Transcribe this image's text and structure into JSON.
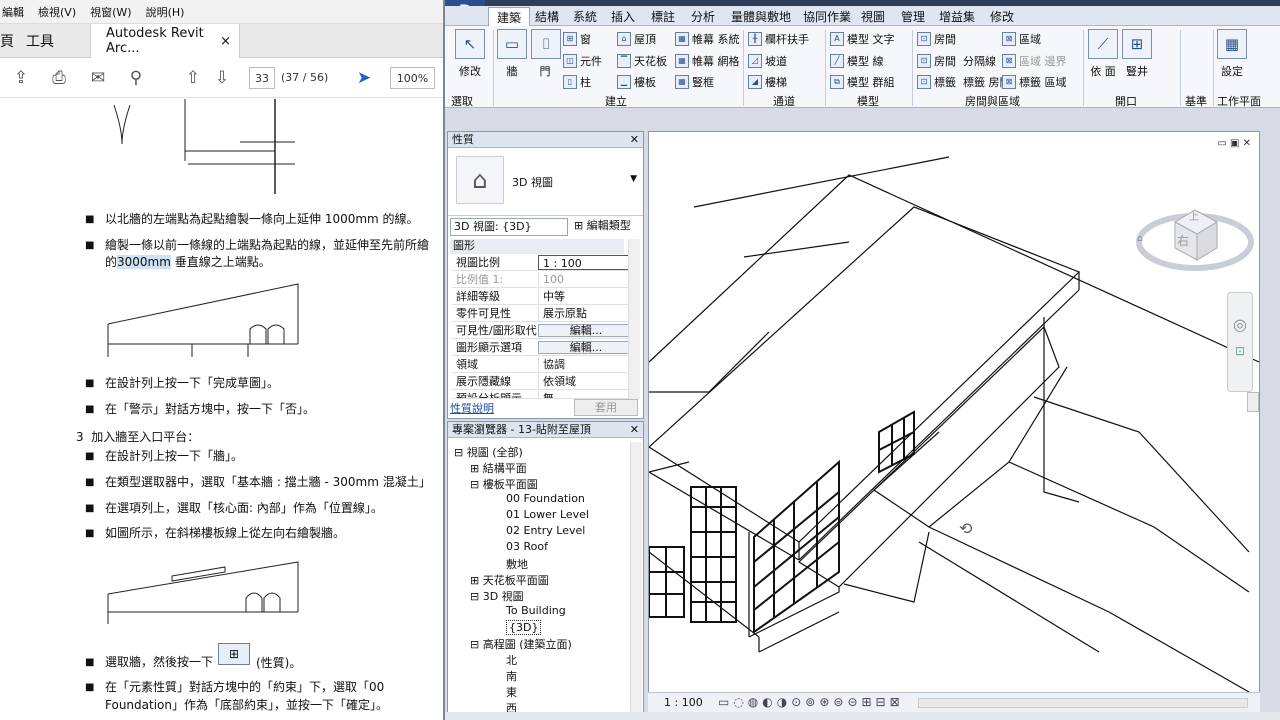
{
  "pdf": {
    "menu": [
      "編輯",
      "檢視(V)",
      "視窗(W)",
      "說明(H)"
    ],
    "tabs": {
      "left": "頁",
      "tools": "工具",
      "doc": "Autodesk Revit Arc...",
      "close": "×"
    },
    "page_num": "33",
    "page_of": "(37 / 56)",
    "zoom": "100%",
    "bullets": [
      "以北牆的左端點為起點繪製一條向上延伸 1000mm 的線。",
      "繪製一條以前一條線的上端點為起點的線，並延伸至先前所繪",
      "在設計列上按一下「完成草圖」。",
      "在「警示」對話方塊中，按一下「否」。",
      "在設計列上按一下「牆」。",
      "在類型選取器中，選取「基本牆 : 擋土牆 - 300mm 混凝土」",
      "在選項列上，選取「核心面: 內部」作為「位置線」。",
      "如圖所示，在斜梯樓板線上從左向右繪製牆。",
      "選取牆，然後按一下",
      "在「元素性質」對話方塊中的「約束」下，選取「00"
    ],
    "b2_cont_pre": "的",
    "b2_cont_hl": "3000mm",
    "b2_cont_post": "垂直線之上端點。",
    "b_icon_suffix": "(性質)。",
    "b_last_cont": "Foundation」作為「底部約束」，並按一下「確定」。",
    "step3": "3  加入牆至入口平台："
  },
  "revit": {
    "tabs": [
      "建築",
      "結構",
      "系統",
      "插入",
      "標註",
      "分析",
      "量體與敷地",
      "協同作業",
      "視圖",
      "管理",
      "增益集",
      "修改"
    ],
    "ribbon": {
      "modify": "修改",
      "select": "選取",
      "wall": "牆",
      "door": "門",
      "window": "窗",
      "component": "元件",
      "column": "柱",
      "roof": "屋頂",
      "ceiling": "天花板",
      "floor": "樓板",
      "curtain_system": "帷幕 系統",
      "curtain_grid": "帷幕 網格",
      "mullion": "豎框",
      "railing": "欄杆扶手",
      "ramp": "坡道",
      "stair": "樓梯",
      "model_text": "模型 文字",
      "model_line": "模型 線",
      "model_group": "模型 群組",
      "room": "房間",
      "room_sep": "分隔線",
      "tag_room": "標籤 房間",
      "area": "區域",
      "area_boundary": "區域 邊界",
      "tag_area": "標籤 區域",
      "by_face": "依 面",
      "shaft": "豎井",
      "set": "設定",
      "panel_build": "建立",
      "panel_circ": "通道",
      "panel_model": "模型",
      "panel_room": "房間與區域",
      "panel_opening": "開口",
      "panel_datum": "基準",
      "panel_work": "工作平面",
      "panel_room_tag": "房間",
      "room_tag_2": "標籤"
    },
    "properties": {
      "title": "性質",
      "type_name": "3D 視圖",
      "selector": "3D 視圖: {3D}",
      "edit_type": "編輯類型",
      "group": "圖形",
      "rows": [
        {
          "k": "視圖比例",
          "v": "1 : 100"
        },
        {
          "k": "比例值 1:",
          "v": "100"
        },
        {
          "k": "詳細等級",
          "v": "中等"
        },
        {
          "k": "零件可見性",
          "v": "展示原點"
        },
        {
          "k": "可見性/圖形取代",
          "v": "編輯..."
        },
        {
          "k": "圖形顯示選項",
          "v": "編輯..."
        },
        {
          "k": "領域",
          "v": "協調"
        },
        {
          "k": "展示隱藏線",
          "v": "依領域"
        },
        {
          "k": "預設分析顯示...",
          "v": "無"
        }
      ],
      "help": "性質說明",
      "apply": "套用"
    },
    "browser": {
      "title": "專案瀏覽器 - 13-貼附至屋頂",
      "items": [
        "視圖 (全部)",
        "結構平面",
        "樓板平面圖",
        "00 Foundation",
        "01 Lower Level",
        "02 Entry Level",
        "03 Roof",
        "敷地",
        "天花板平面圖",
        "3D 視圖",
        "To Building",
        "{3D}",
        "高程圖 (建築立面)",
        "北",
        "南",
        "東",
        "西"
      ]
    },
    "viewcube_labels": [
      "上",
      "右"
    ],
    "scale": "1 : 100"
  }
}
